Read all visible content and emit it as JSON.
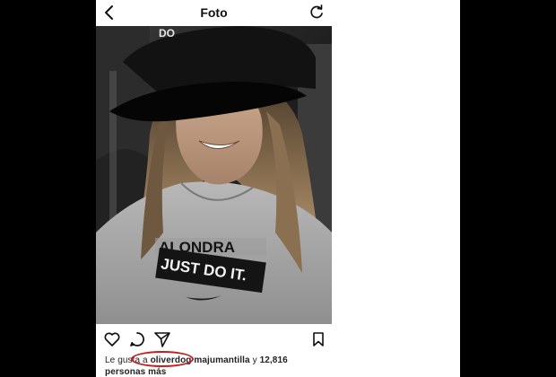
{
  "header": {
    "title": "Foto",
    "back_icon": "chevron-left-icon",
    "refresh_icon": "refresh-icon"
  },
  "photo": {
    "cap_text": "DO",
    "shirt_line1": "ALONDRA",
    "shirt_line2": "JUST DO IT."
  },
  "actions": {
    "icons": [
      "heart-icon",
      "comment-icon",
      "share-icon",
      "bookmark-icon"
    ]
  },
  "likes": {
    "prefix": "Le gusta a ",
    "user1": "oliverdog",
    "user2": "majumantilla",
    "middle": " y ",
    "count": "12,816",
    "suffix": "personas más"
  },
  "colors": {
    "highlight_oval": "#c41d1d",
    "background": "#ffffff",
    "letterbox": "#000000"
  }
}
